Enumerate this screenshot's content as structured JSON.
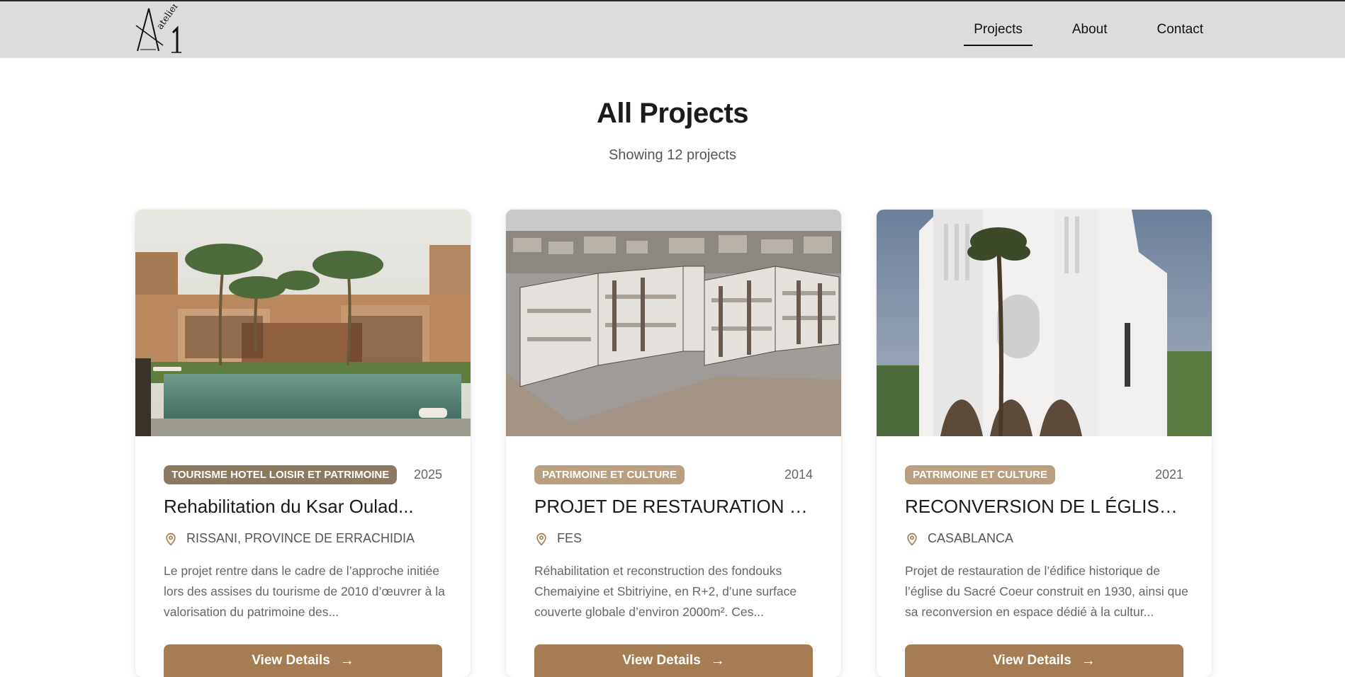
{
  "nav": {
    "logo_text": "Atelier 1",
    "items": [
      {
        "label": "Projects",
        "active": true
      },
      {
        "label": "About",
        "active": false
      },
      {
        "label": "Contact",
        "active": false
      }
    ]
  },
  "main": {
    "title": "All Projects",
    "subtitle": "Showing 12 projects"
  },
  "colors": {
    "accent": "#a67c52",
    "badge_dark": "#8b7962",
    "badge_light": "#b99f7f",
    "navbar_bg": "#dcdcdc"
  },
  "projects": [
    {
      "category": "TOURISME HOTEL LOISIR ET PATRIMOINE",
      "year": "2025",
      "title": "Rehabilitation du Ksar Oulad...",
      "location": "RISSANI, PROVINCE DE ERRACHIDIA",
      "description": "Le projet rentre dans le cadre de l’approche initiée lors des assises du tourisme de 2010 d’œuvrer à la valorisation du patrimoine des...",
      "button": "View Details",
      "image_icon": "courtyard-pool-photo"
    },
    {
      "category": "PATRIMOINE ET CULTURE",
      "year": "2014",
      "title": "PROJET DE RESTAURATION ET...",
      "location": "FES",
      "description": "Réhabilitation et reconstruction des fondouks Chemaiyine et Sbitriyine, en R+2, d’une surface couverte globale d’environ 2000m². Ces...",
      "button": "View Details",
      "image_icon": "building-section-render"
    },
    {
      "category": "PATRIMOINE ET CULTURE",
      "year": "2021",
      "title": "RECONVERSION DE L ÉGLISE D...",
      "location": "CASABLANCA",
      "description": "Projet de restauration de l’édifice historique de l’église du Sacré Coeur construit en 1930, ainsi que sa reconversion en espace dédié à la cultur...",
      "button": "View Details",
      "image_icon": "white-church-photo"
    }
  ]
}
